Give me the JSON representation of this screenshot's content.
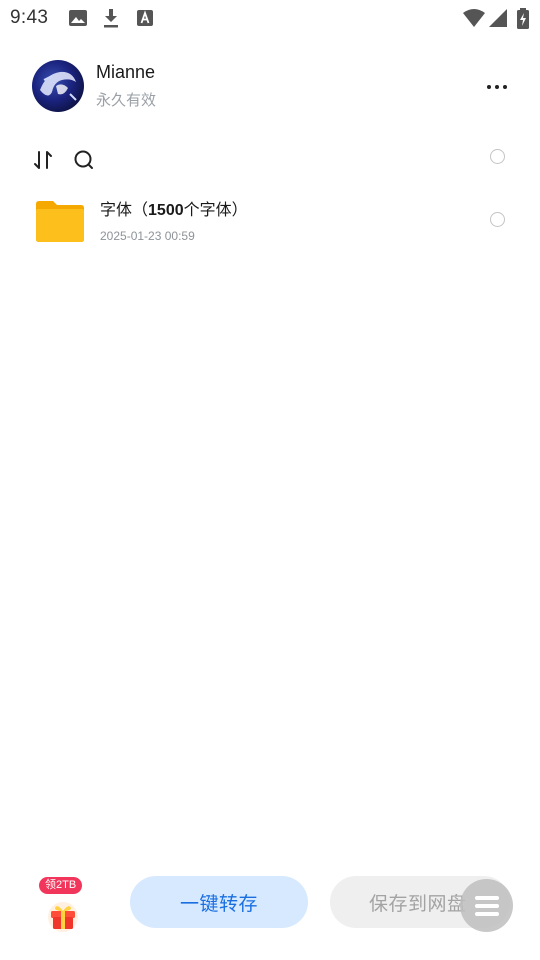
{
  "status_bar": {
    "time": "9:43"
  },
  "profile": {
    "name": "Mianne",
    "validity": "永久有效"
  },
  "file_list": {
    "items": [
      {
        "name_prefix": "字体（",
        "name_bold": "1500",
        "name_suffix": "个字体）",
        "date": "2025-01-23 00:59"
      }
    ]
  },
  "bottom_bar": {
    "gift_badge": "领2TB",
    "transfer_button": "一键转存",
    "save_button": "保存到网盘"
  },
  "colors": {
    "primary_blue": "#1a6fe0",
    "primary_blue_bg": "#d7e9ff",
    "badge_red": "#f2365b",
    "folder_yellow": "#fdbf1c"
  }
}
